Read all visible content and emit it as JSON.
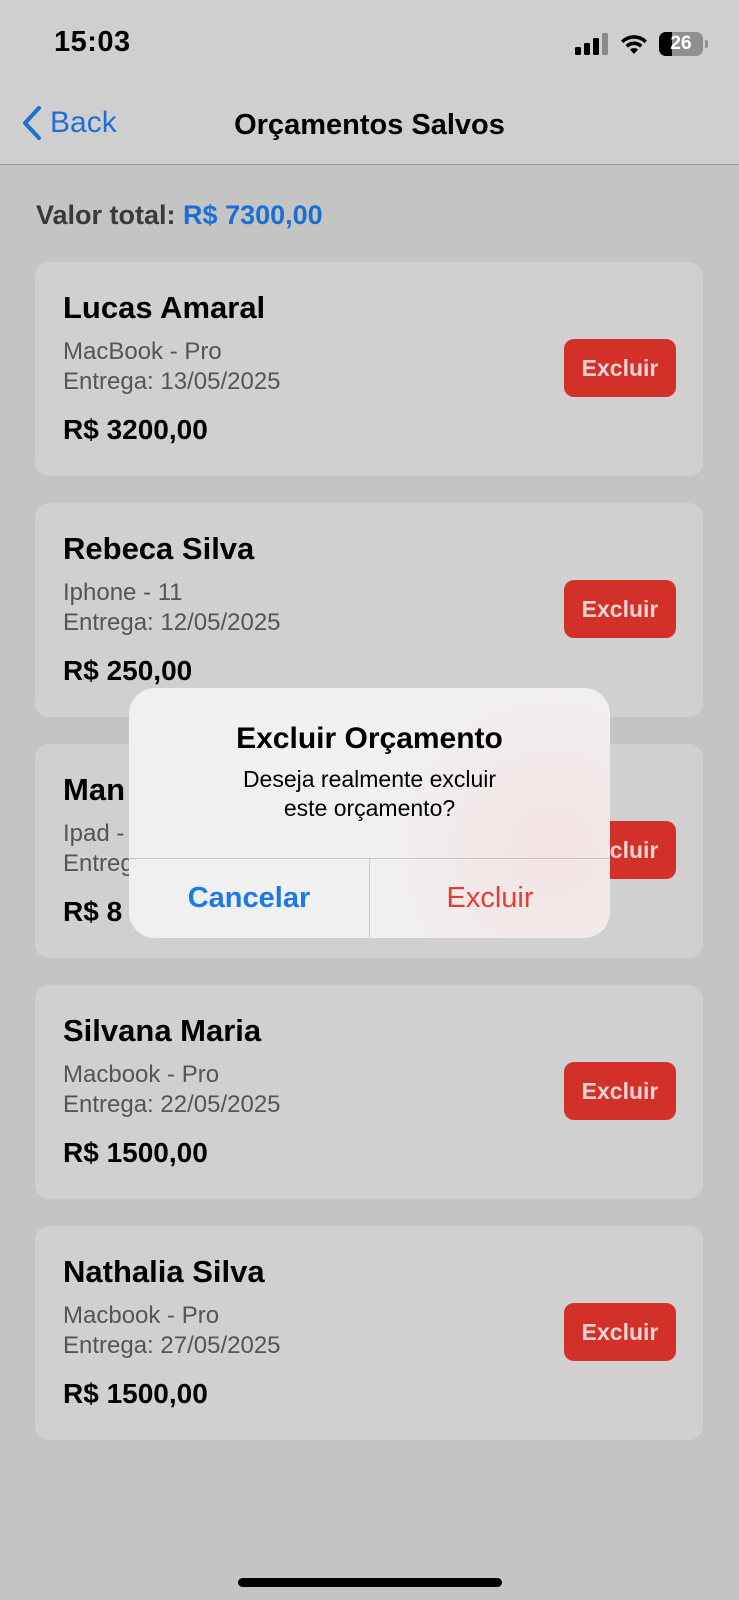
{
  "status_bar": {
    "time": "15:03",
    "battery": "26",
    "icons": [
      "signal-icon",
      "wifi-icon",
      "battery-icon"
    ]
  },
  "nav": {
    "back_label": "Back",
    "title": "Orçamentos Salvos"
  },
  "summary": {
    "total_label": "Valor total:",
    "total_value": "R$ 7300,00"
  },
  "colors": {
    "accent": "#1b6fd2",
    "danger": "#d4302a",
    "background": "#c4c4c4",
    "card": "#d0d0d0"
  },
  "budgets": [
    {
      "name": "Lucas Amaral",
      "device": "MacBook - Pro",
      "delivery": "Entrega: 13/05/2025",
      "price": "R$ 3200,00",
      "delete_label": "Excluir"
    },
    {
      "name": "Rebeca Silva",
      "device": "Iphone - 11",
      "delivery": "Entrega: 12/05/2025",
      "price": "R$ 250,00",
      "delete_label": "Excluir"
    },
    {
      "name": "Man",
      "device": "Ipad -",
      "delivery": "Entreg",
      "price": "R$ 8",
      "delete_label": "Excluir"
    },
    {
      "name": "Silvana Maria",
      "device": "Macbook - Pro",
      "delivery": "Entrega: 22/05/2025",
      "price": "R$ 1500,00",
      "delete_label": "Excluir"
    },
    {
      "name": "Nathalia Silva",
      "device": "Macbook - Pro",
      "delivery": "Entrega: 27/05/2025",
      "price": "R$ 1500,00",
      "delete_label": "Excluir"
    }
  ],
  "alert": {
    "title": "Excluir Orçamento",
    "message": "Deseja realmente excluir este orçamento?",
    "cancel_label": "Cancelar",
    "confirm_label": "Excluir"
  }
}
